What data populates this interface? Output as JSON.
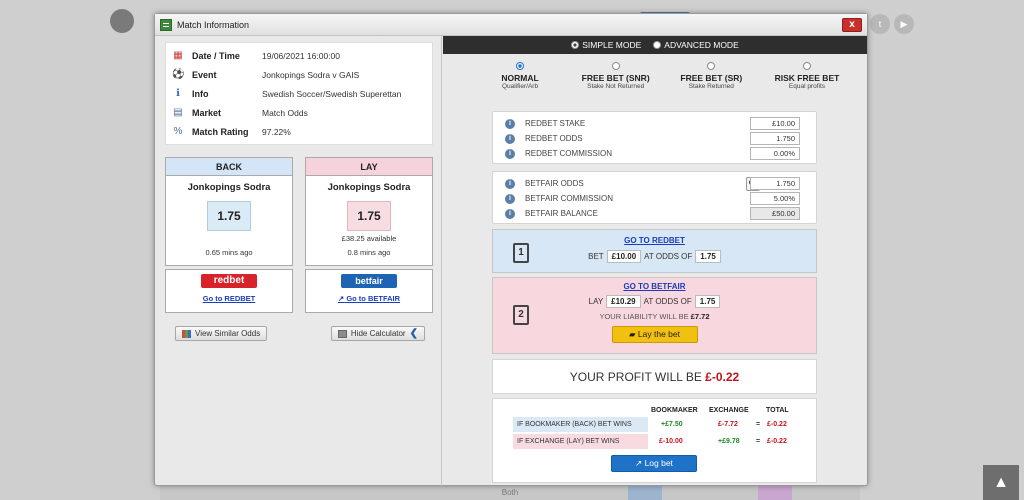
{
  "background": {
    "scroll_top_glyph": "▲",
    "bottom_label": "Both",
    "social": [
      "t",
      "▶"
    ]
  },
  "modal": {
    "title": "Match Information",
    "close": "x"
  },
  "match": {
    "rows": [
      {
        "icon": "calendar-icon",
        "glyph": "▦",
        "label": "Date / Time",
        "value": "19/06/2021 16:00:00"
      },
      {
        "icon": "football-icon",
        "glyph": "⚽",
        "label": "Event",
        "value": "Jonkopings Sodra v GAIS"
      },
      {
        "icon": "info-icon",
        "glyph": "ℹ",
        "label": "Info",
        "value": "Swedish Soccer/Swedish Superettan"
      },
      {
        "icon": "market-icon",
        "glyph": "▤",
        "label": "Market",
        "value": "Match Odds"
      },
      {
        "icon": "rating-icon",
        "glyph": "%",
        "label": "Match Rating",
        "value": "97.22%"
      }
    ]
  },
  "back": {
    "header": "BACK",
    "team": "Jonkopings Sodra",
    "price": "1.75",
    "available": "",
    "age": "0.65 mins ago"
  },
  "lay": {
    "header": "LAY",
    "team": "Jonkopings Sodra",
    "price": "1.75",
    "available": "£38.25 available",
    "age": "0.8 mins ago"
  },
  "bookmakers": {
    "redbet_logo": "redbet",
    "redbet_link": "Go to REDBET",
    "betfair_logo": "betfair",
    "betfair_link": "Go to BETFAIR"
  },
  "buttons": {
    "similar_odds": "View Similar Odds",
    "hide_calculator": "Hide Calculator"
  },
  "mode_bar": {
    "simple": "SIMPLE MODE",
    "advanced": "ADVANCED MODE",
    "selected": "simple"
  },
  "modes": [
    {
      "title": "NORMAL",
      "sub": "Qualifier/Arb",
      "selected": true
    },
    {
      "title": "FREE BET (SNR)",
      "sub": "Stake Not Returned",
      "selected": false
    },
    {
      "title": "FREE BET (SR)",
      "sub": "Stake Returned",
      "selected": false
    },
    {
      "title": "RISK FREE BET",
      "sub": "Equal profits",
      "selected": false
    }
  ],
  "bookie_inputs": [
    {
      "label": "REDBET STAKE",
      "value": "£10.00"
    },
    {
      "label": "REDBET ODDS",
      "value": "1.750"
    },
    {
      "label": "REDBET COMMISSION",
      "value": "0.00%"
    }
  ],
  "exchange_inputs": [
    {
      "label": "BETFAIR ODDS",
      "value": "1.750"
    },
    {
      "label": "BETFAIR COMMISSION",
      "value": "5.00%"
    },
    {
      "label": "BETFAIR BALANCE",
      "value": "£50.00"
    }
  ],
  "step1": {
    "num": "1",
    "link": "GO TO REDBET",
    "bet_label": "BET",
    "stake": "£10.00",
    "at_odds_label": "AT ODDS OF",
    "odds": "1.75"
  },
  "step2": {
    "num": "2",
    "link": "GO TO BETFAIR",
    "lay_label": "LAY",
    "stake": "£10.29",
    "at_odds_label": "AT ODDS OF",
    "odds": "1.75",
    "liability_label": "YOUR LIABILITY WILL BE",
    "liability": "£7.72",
    "lay_button": "Lay the bet"
  },
  "profit": {
    "label": "YOUR PROFIT WILL BE",
    "value": "£-0.22"
  },
  "summary": {
    "headers": [
      "BOOKMAKER",
      "EXCHANGE",
      "TOTAL"
    ],
    "rows": [
      {
        "label": "IF BOOKMAKER (BACK) BET WINS",
        "bookmaker": "+£7.50",
        "exchange": "£-7.72",
        "eq": "=",
        "total": "£-0.22"
      },
      {
        "label": "IF EXCHANGE (LAY) BET WINS",
        "bookmaker": "£-10.00",
        "exchange": "+£9.78",
        "eq": "=",
        "total": "£-0.22"
      }
    ],
    "log_button": "Log bet"
  },
  "colors": {
    "back": "#d3e5f6",
    "lay": "#f6d3da",
    "accent": "#1e73c8",
    "negative": "#c0141b",
    "positive": "#1e8a1e",
    "lay_button": "#f2c011"
  }
}
